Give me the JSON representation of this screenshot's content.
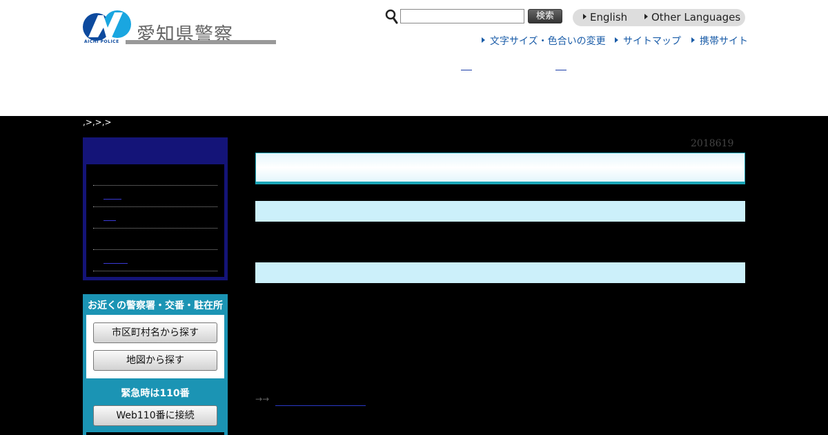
{
  "header": {
    "logo_title": "愛知県警察",
    "logo_subtitle": "AICHI POLICE",
    "search": {
      "value": "",
      "placeholder": "",
      "button_label": "検索"
    },
    "languages": [
      {
        "label": "English"
      },
      {
        "label": "Other Languages"
      }
    ],
    "utility_links": [
      {
        "label": "文字サイズ・色合いの変更"
      },
      {
        "label": "サイトマップ"
      },
      {
        "label": "携帯サイト"
      }
    ]
  },
  "breadcrumb": {
    "text": ",>,>,>"
  },
  "main": {
    "date": "2018619",
    "arrow_text": "→→"
  },
  "finder": {
    "title": "お近くの警察署・交番・駐在所",
    "city_button": "市区町村名から探す",
    "map_button": "地図から探す",
    "emergency_text": "緊急時は110番",
    "web110_button": "Web110番に接続"
  },
  "colors": {
    "brand_blue": "#0d4a9e",
    "menu_navy": "#141478",
    "finder_teal": "#1b94b4",
    "section_light_blue": "#ccf0fa",
    "title_border": "#1aa6b8",
    "link_blue": "#1a5ca8"
  },
  "icons": [
    "aichi-police-logo-icon",
    "search-icon",
    "triangle-right-icon"
  ]
}
